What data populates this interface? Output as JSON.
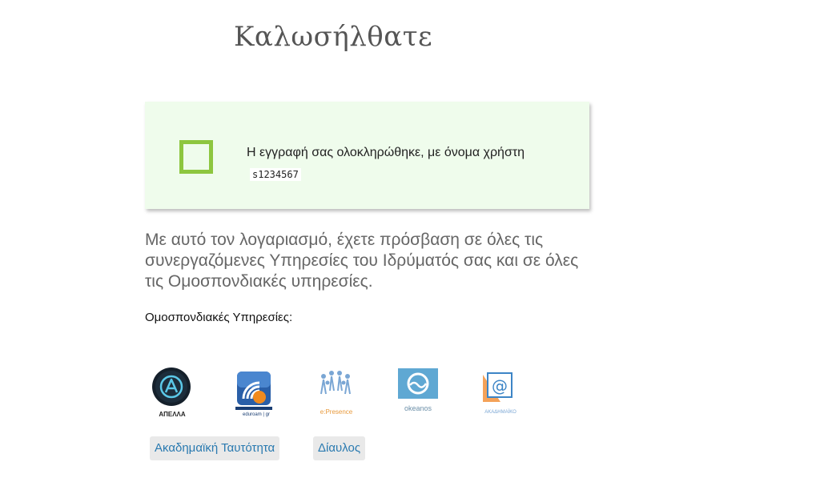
{
  "header": {
    "title": "Καλωσήλθατε"
  },
  "success": {
    "message": "Η εγγραφή σας ολοκληρώθηκε, με όνομα χρήστη",
    "username": "s1234567",
    "icon": "check-square-icon",
    "icon_color": "#8dc63f",
    "background": "#effcec"
  },
  "access": {
    "text": "Με αυτό τον λογαριασμό, έχετε πρόσβαση σε όλες τις συνεργαζόμενες Υπηρεσίες του Ιδρύματός σας και σε όλες τις Ομοσπονδιακές υπηρεσίες."
  },
  "services": {
    "label": "Ομοσπονδιακές Υπηρεσίες:",
    "logos": [
      {
        "name": "apella-logo",
        "caption": "ΑΠΕΛΛΑ"
      },
      {
        "name": "eduroam-logo",
        "caption": "eduroam | gr"
      },
      {
        "name": "epresence-logo",
        "caption": "e:Presence"
      },
      {
        "name": "okeanos-logo",
        "caption": "okeanos"
      },
      {
        "name": "academic-mail-logo",
        "caption": "ΑΚΑΔΗΜΑΪΚΟ"
      }
    ]
  },
  "tags": [
    {
      "label": "Ακαδημαϊκή Ταυτότητα"
    },
    {
      "label": "Δίαυλος"
    }
  ],
  "colors": {
    "link": "#2a7ab0",
    "tag_bg": "#e9e9e9",
    "title": "#555555"
  }
}
